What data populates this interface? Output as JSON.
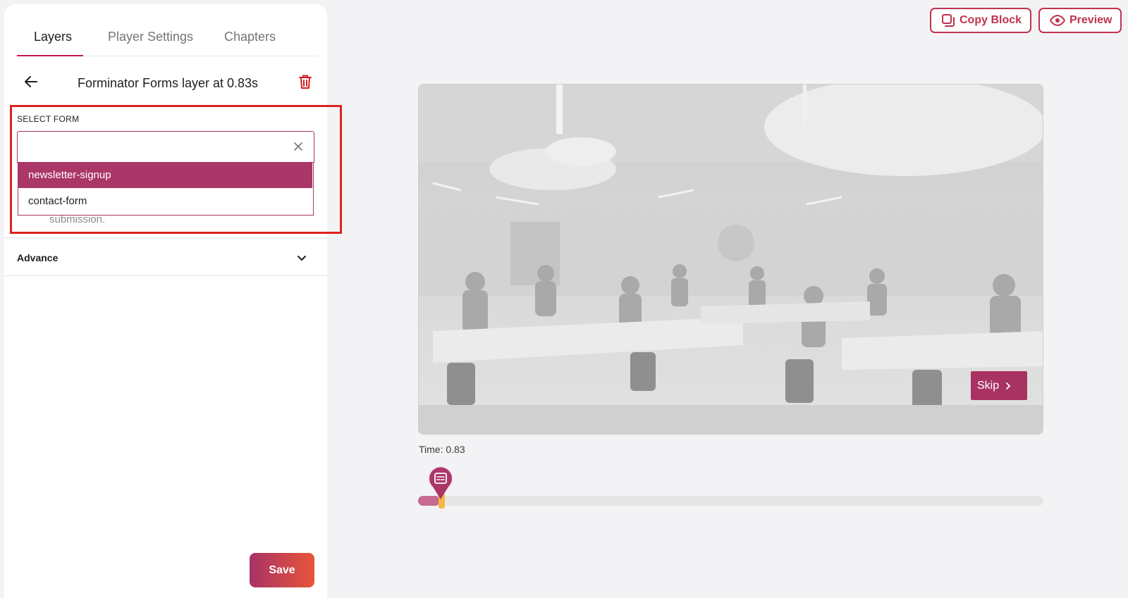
{
  "tabs": [
    {
      "label": "Layers",
      "active": true
    },
    {
      "label": "Player Settings",
      "active": false
    },
    {
      "label": "Chapters",
      "active": false
    }
  ],
  "layer": {
    "title": "Forminator Forms layer at 0.83s"
  },
  "form_select": {
    "label": "SELECT FORM",
    "value": "",
    "options": [
      "newsletter-signup",
      "contact-form"
    ],
    "highlighted_option": "newsletter-signup"
  },
  "help_text": "submission.",
  "advance": {
    "label": "Advance"
  },
  "save_label": "Save",
  "toolbar": {
    "copy_label": "Copy Block",
    "preview_label": "Preview"
  },
  "player": {
    "skip_label": "Skip",
    "time_label": "Time: 0.83",
    "progress_fraction": 0.035
  },
  "colors": {
    "brand": "#ab3668",
    "accent_red": "#c0324e",
    "highlight_box": "#dd2222",
    "thumb": "#f5b942"
  },
  "icons": [
    "back-arrow-icon",
    "trash-icon",
    "close-icon",
    "chevron-down-icon",
    "copy-icon",
    "eye-icon",
    "chevron-right-icon",
    "form-layer-marker-icon"
  ]
}
